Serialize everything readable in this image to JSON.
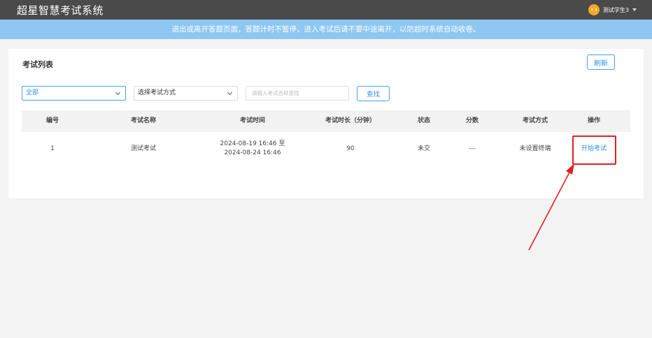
{
  "header": {
    "app_title": "超星智慧考试系统",
    "user_name": "测试学生3",
    "avatar_text": "3 3"
  },
  "notice": "退出或离开答题页面，答题计时不暂停，进入考试后请不要中途离开，以防超时系统自动收卷。",
  "exam_list": {
    "title": "考试列表",
    "refresh_label": "刷新",
    "filter_status": "全部",
    "filter_method": "选择考试方式",
    "search_placeholder": "请输入考试名称查找",
    "search_button": "查找",
    "columns": [
      "编号",
      "考试名称",
      "考试时间",
      "考试时长（分钟）",
      "状态",
      "分数",
      "考试方式",
      "操作"
    ],
    "rows": [
      {
        "id": "1",
        "name": "测试考试",
        "time_start": "2024-08-19 16:46 至",
        "time_end": "2024-08-24 16:46",
        "duration": "90",
        "status": "未交",
        "score": "---",
        "method": "未设置终端",
        "action": "开始考试"
      }
    ]
  },
  "colors": {
    "topbar": "#4a4a4a",
    "notice_bg": "#8ec7f1",
    "accent": "#2f8ef0",
    "annotation": "#e02020"
  }
}
